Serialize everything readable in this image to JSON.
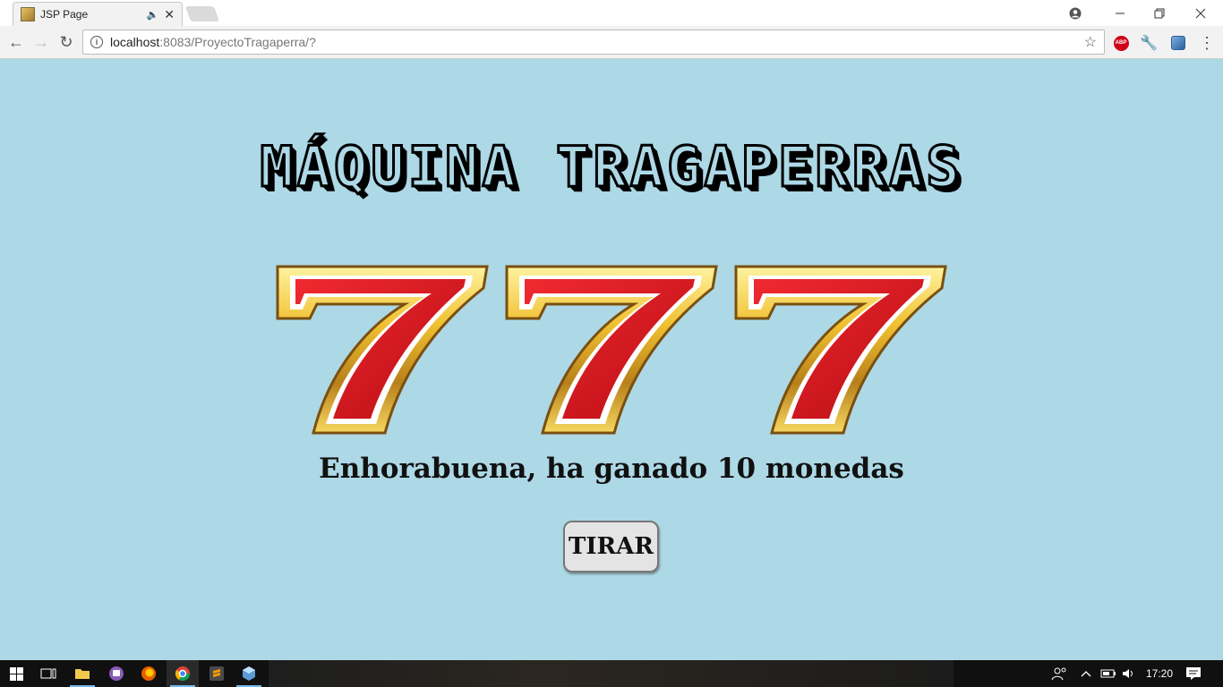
{
  "browser": {
    "tab": {
      "title": "JSP Page"
    },
    "address": {
      "host": "localhost",
      "rest": ":8083/ProyectoTragaperra/?"
    },
    "extensions": {
      "abp_label": "ABP"
    }
  },
  "page": {
    "title": "MÁQUINA TRAGAPERRAS",
    "reels": [
      "7",
      "7",
      "7"
    ],
    "message": "Enhorabuena, ha ganado 10 monedas",
    "spin_label": "TIRAR"
  },
  "taskbar": {
    "clock": "17:20"
  },
  "colors": {
    "background": "#add8e6",
    "seven_red": "#d8141c",
    "seven_gold": "#e8b020"
  }
}
